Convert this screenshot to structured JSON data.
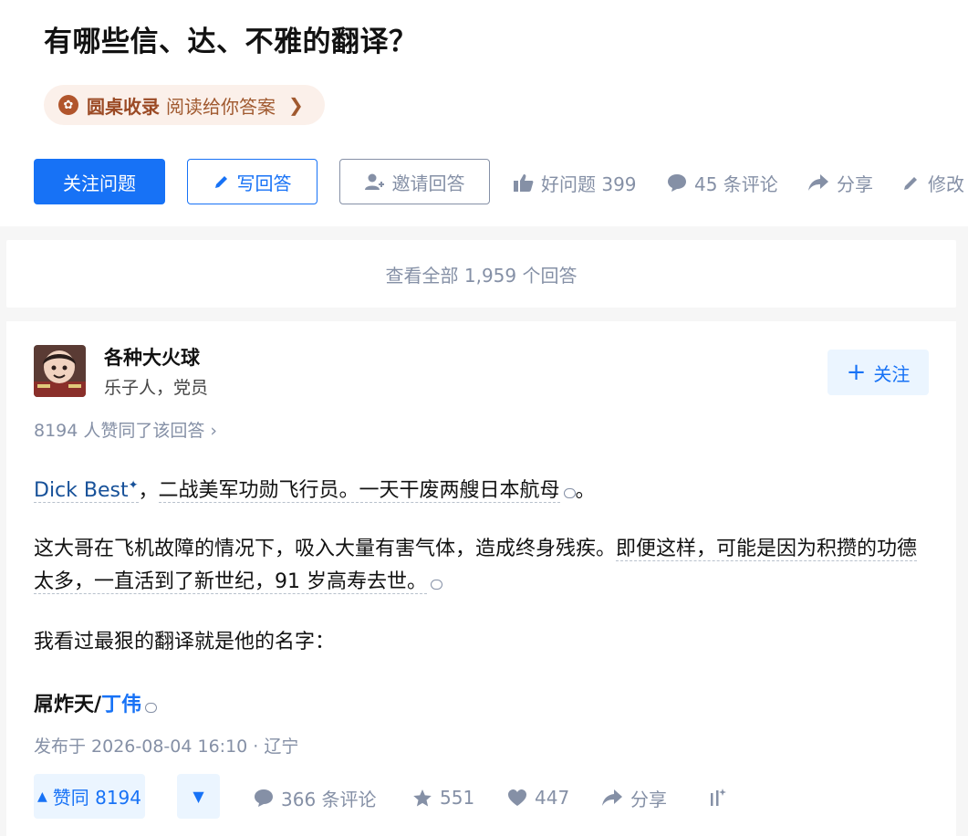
{
  "question": {
    "title": "有哪些信、达、不雅的翻译？",
    "pill": {
      "brand": "圆桌收录",
      "text": "阅读给你答案",
      "chevron": "❯"
    },
    "buttons": {
      "follow": "关注问题",
      "write": "写回答",
      "invite": "邀请回答"
    },
    "actions": {
      "good_question": "好问题 399",
      "comments": "45 条评论",
      "share": "分享",
      "edit": "修改"
    }
  },
  "view_all": "查看全部 1,959 个回答",
  "answer": {
    "author": {
      "name": "各种大火球",
      "bio": "乐子人，党员"
    },
    "follow_button": "关注",
    "agree_line": "8194 人赞同了该回答 ›",
    "p1": {
      "link": "Dick Best",
      "sup": "✦",
      "sep": "，",
      "text": "二战美军功勋飞行员。一天干废两艘日本航母",
      "end": "。"
    },
    "p2": {
      "a": "这大哥在飞机故障的情况下，吸入大量有害气体，造成终身残疾。",
      "b": "即便这样，可能是因为积攒的功德太多，一直活到了新世纪，91 岁高寿去世。"
    },
    "p3": "我看过最狠的翻译就是他的名字：",
    "p4": {
      "a": "屌炸天/",
      "b": "丁伟"
    },
    "pubtime": "发布于 2026-08-04 16:10 · 辽宁",
    "vote_up": "赞同 8194",
    "footer": {
      "comments": "366 条评论",
      "favorites": "551",
      "likes": "447",
      "share": "分享"
    }
  },
  "colors": {
    "accent": "#1772f6",
    "muted": "#8590a6",
    "pill_bg": "#fbf0ea",
    "link": "#175199"
  }
}
